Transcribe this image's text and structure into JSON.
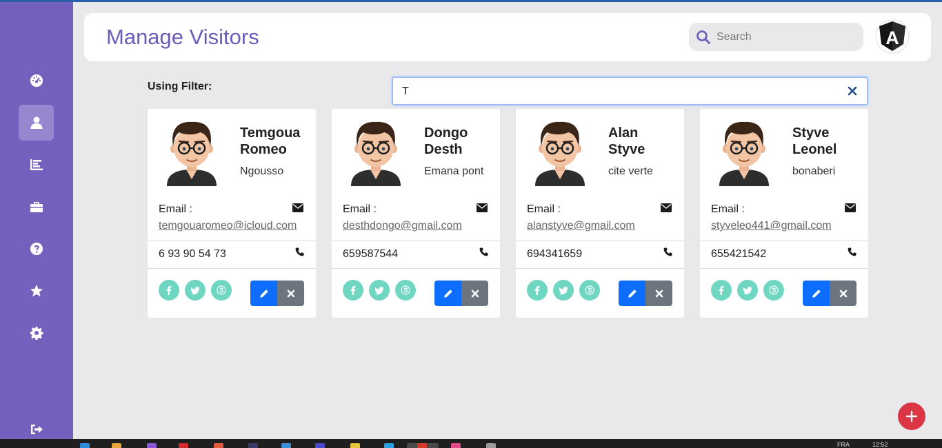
{
  "header": {
    "title": "Manage Visitors",
    "search_placeholder": "Search",
    "avatar_letter": "A"
  },
  "sidebar": {
    "items": [
      {
        "icon": "dashboard-icon",
        "active": false
      },
      {
        "icon": "user-icon",
        "active": true
      },
      {
        "icon": "bar-chart-icon",
        "active": false
      },
      {
        "icon": "briefcase-icon",
        "active": false
      },
      {
        "icon": "help-icon",
        "active": false
      },
      {
        "icon": "star-icon",
        "active": false
      },
      {
        "icon": "gear-icon",
        "active": false
      },
      {
        "icon": "logout-icon",
        "active": false
      }
    ]
  },
  "filter": {
    "label": "Using Filter:",
    "value": "T"
  },
  "email_label": "Email :",
  "visitors": [
    {
      "first_name": "Temgoua",
      "last_name": "Romeo",
      "place": "Ngousso",
      "email": "temgouaromeo@icloud.com",
      "phone": "6 93 90 54 73"
    },
    {
      "first_name": "Dongo",
      "last_name": "Desth",
      "place": "Emana pont",
      "email": "desthdongo@gmail.com",
      "phone": "659587544"
    },
    {
      "first_name": "Alan",
      "last_name": "Styve",
      "place": "cite verte",
      "email": "alanstyve@gmail.com",
      "phone": "694341659"
    },
    {
      "first_name": "Styve",
      "last_name": "Leonel",
      "place": "bonaberi",
      "email": "styveleo441@gmail.com",
      "phone": "655421542"
    }
  ],
  "taskbar": {
    "language": "FRA",
    "time": "12:52"
  },
  "colors": {
    "sidebar": "#7461bd",
    "accent": "#6c5bb8",
    "social": "#6fd6c1",
    "edit": "#0d6efd",
    "delete": "#6c757d",
    "fab": "#dc3545"
  }
}
